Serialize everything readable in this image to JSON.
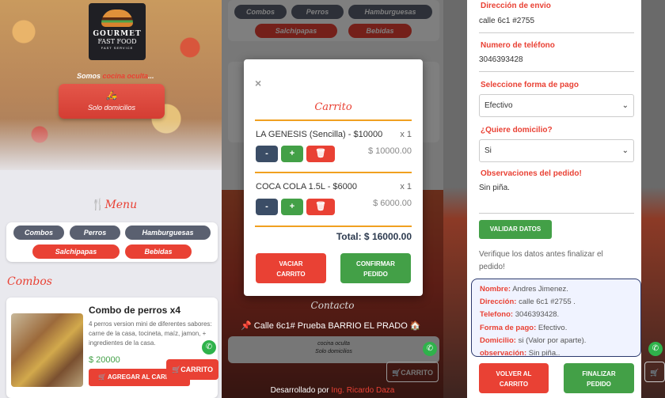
{
  "panel1": {
    "logo": {
      "line1": "GOURMET",
      "line2": "FAST FOOD",
      "line3": "FAST SERVICE"
    },
    "tagline_prefix": "Somos",
    "tagline_highlight": "cocina oculta",
    "tagline_suffix": "...",
    "delivery_button": "Solo domicilios",
    "menu_title": "Menu",
    "categories": [
      "Combos",
      "Perros",
      "Hamburguesas",
      "Salchipapas",
      "Bebidas"
    ],
    "section_title": "Combos",
    "product": {
      "name": "Combo de perros x4",
      "description": "4 perros version mini de diferentes sabores: carne de la casa, tocineta, maíz, jamon, + ingredientes de la casa.",
      "price": "$ 20000",
      "add_button": "AGREGAR AL CARRITO"
    },
    "cart_button": "CARRITO"
  },
  "panel2": {
    "close_symbol": "×",
    "modal_title": "Carrito",
    "items": [
      {
        "name": "LA GENESIS (Sencilla) - $10000",
        "qty": "x 1",
        "subtotal": "$ 10000.00"
      },
      {
        "name": "COCA COLA 1.5L - $6000",
        "qty": "x 1",
        "subtotal": "$ 6000.00"
      }
    ],
    "minus": "-",
    "plus": "+",
    "total": "Total: $ 16000.00",
    "clear_button_line1": "VACIAR",
    "clear_button_line2": "CARRITO",
    "confirm_button_line1": "CONFIRMAR",
    "confirm_button_line2": "PEDIDO",
    "background_tabs": [
      "Combos",
      "Perros",
      "Hamburguesas",
      "Salchipapas",
      "Bebidas"
    ],
    "contact_title": "Contacto",
    "address": "Calle 6c1# Prueba BARRIO EL PRADO",
    "footer_card_line1": "cocina oculta",
    "footer_card_line2": "Solo domicilios",
    "cart_button": "CARRITO",
    "footer_prefix": "Desarrollado por",
    "footer_author": "Ing. Ricardo Daza"
  },
  "panel3": {
    "address_label": "Dirección de envio",
    "address_value": "calle 6c1 #2755",
    "phone_label": "Numero de teléfono",
    "phone_value": "3046393428",
    "payment_label": "Seleccione forma de pago",
    "payment_value": "Efectivo",
    "delivery_label": "¿Quiere domicilio?",
    "delivery_value": "Si",
    "notes_label": "Observaciones del pedido!",
    "notes_value": "Sin piña.",
    "validate_button": "VALIDAR DATOS",
    "verify_note": "Verifique los datos antes finalizar el pedido!",
    "summary": [
      {
        "key": "Nombre:",
        "value": "Andres Jimenez."
      },
      {
        "key": "Dirección:",
        "value": "calle 6c1 #2755 ."
      },
      {
        "key": "Telefono:",
        "value": "3046393428."
      },
      {
        "key": "Forma de pago:",
        "value": "Efectivo."
      },
      {
        "key": "Domicilio:",
        "value": "si (Valor por aparte)."
      },
      {
        "key": "observación:",
        "value": "Sin piña.."
      }
    ],
    "back_button_line1": "VOLVER AL",
    "back_button_line2": "CARRITO",
    "finish_button_line1": "FINALIZAR",
    "finish_button_line2": "PEDIDO"
  },
  "colors": {
    "accent_red": "#e94134",
    "green": "#43a047",
    "navy": "#3b4d66",
    "chip_gray": "#5a6070"
  }
}
